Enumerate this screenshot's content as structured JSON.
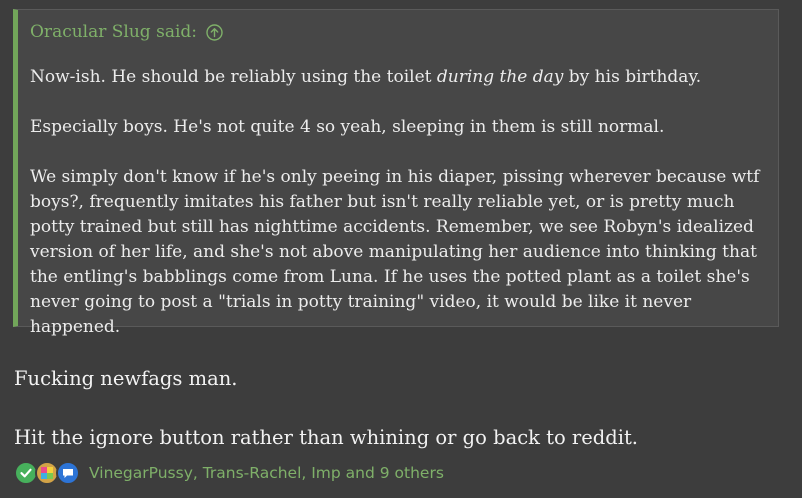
{
  "quote": {
    "author_said": "Oracular Slug said:",
    "jump_icon": "circle-up-arrow-icon",
    "para1_before": "Now-ish. He should be reliably using the toilet ",
    "para1_em": "during the day",
    "para1_after": " by his birthday.",
    "para2": "Especially boys. He's not quite 4 so yeah, sleeping in them is still normal.",
    "para3": "We simply don't know if he's only peeing in his diaper, pissing wherever because wtf boys?, frequently imitates his father but isn't really reliable yet, or is pretty much potty trained but still has nighttime accidents. Remember, we see Robyn's idealized version of her life, and she's not above manipulating her audience into thinking that the entling's babblings come from Luna. If he uses the potted plant as a toilet she's never going to post a \"trials in potty training\" video, it would be like it never happened."
  },
  "post": {
    "line1": "Fucking newfags man.",
    "line2": "Hit the ignore button rather than whining or go back to reddit."
  },
  "reactions": {
    "icons": [
      "checkmark-icon",
      "puzzle-icon",
      "speech-bubble-icon"
    ],
    "users_text": "VinegarPussy, Trans-Rachel, Imp and 9 others"
  },
  "colors": {
    "background": "#3d3d3d",
    "quote_background": "#474747",
    "accent_green": "#7fb069",
    "quote_bar": "#72a65a"
  }
}
